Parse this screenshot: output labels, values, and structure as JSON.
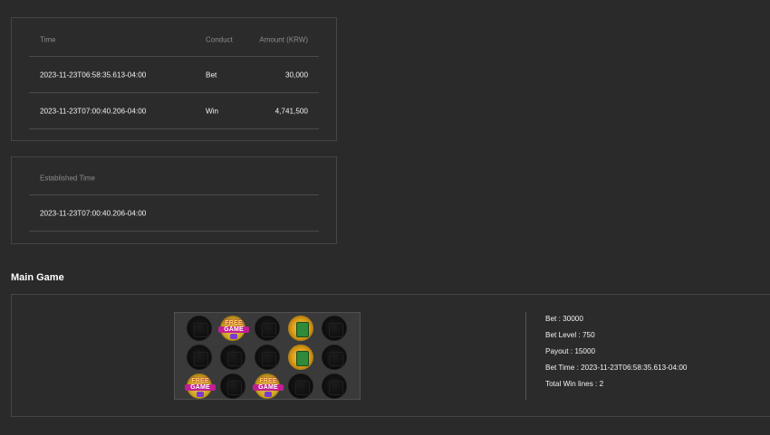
{
  "transactions": {
    "headers": {
      "time": "Time",
      "conduct": "Conduct",
      "amount": "Amount (KRW)"
    },
    "rows": [
      {
        "time": "2023-11-23T06:58:35.613-04:00",
        "conduct": "Bet",
        "amount": "30,000"
      },
      {
        "time": "2023-11-23T07:00:40.206-04:00",
        "conduct": "Win",
        "amount": "4,741,500"
      }
    ]
  },
  "established": {
    "header": "Established Time",
    "value": "2023-11-23T07:00:40.206-04:00"
  },
  "main_game": {
    "title": "Main Game",
    "free_game_text": {
      "top": "FREE",
      "bottom": "GAME"
    },
    "grid": [
      [
        "empty-symbol",
        "free-game-symbol",
        "empty-symbol",
        "wild-symbol",
        "empty-symbol"
      ],
      [
        "empty-symbol",
        "empty-symbol",
        "empty-symbol",
        "wild-symbol",
        "empty-symbol"
      ],
      [
        "free-game-symbol",
        "empty-symbol",
        "free-game-symbol",
        "empty-symbol",
        "empty-symbol"
      ]
    ],
    "info": {
      "bet": "Bet : 30000",
      "bet_level": "Bet Level : 750",
      "payout": "Payout : 15000",
      "bet_time": "Bet Time : 2023-11-23T06:58:35.613-04:00",
      "total_win_lines": "Total Win lines : 2"
    }
  }
}
